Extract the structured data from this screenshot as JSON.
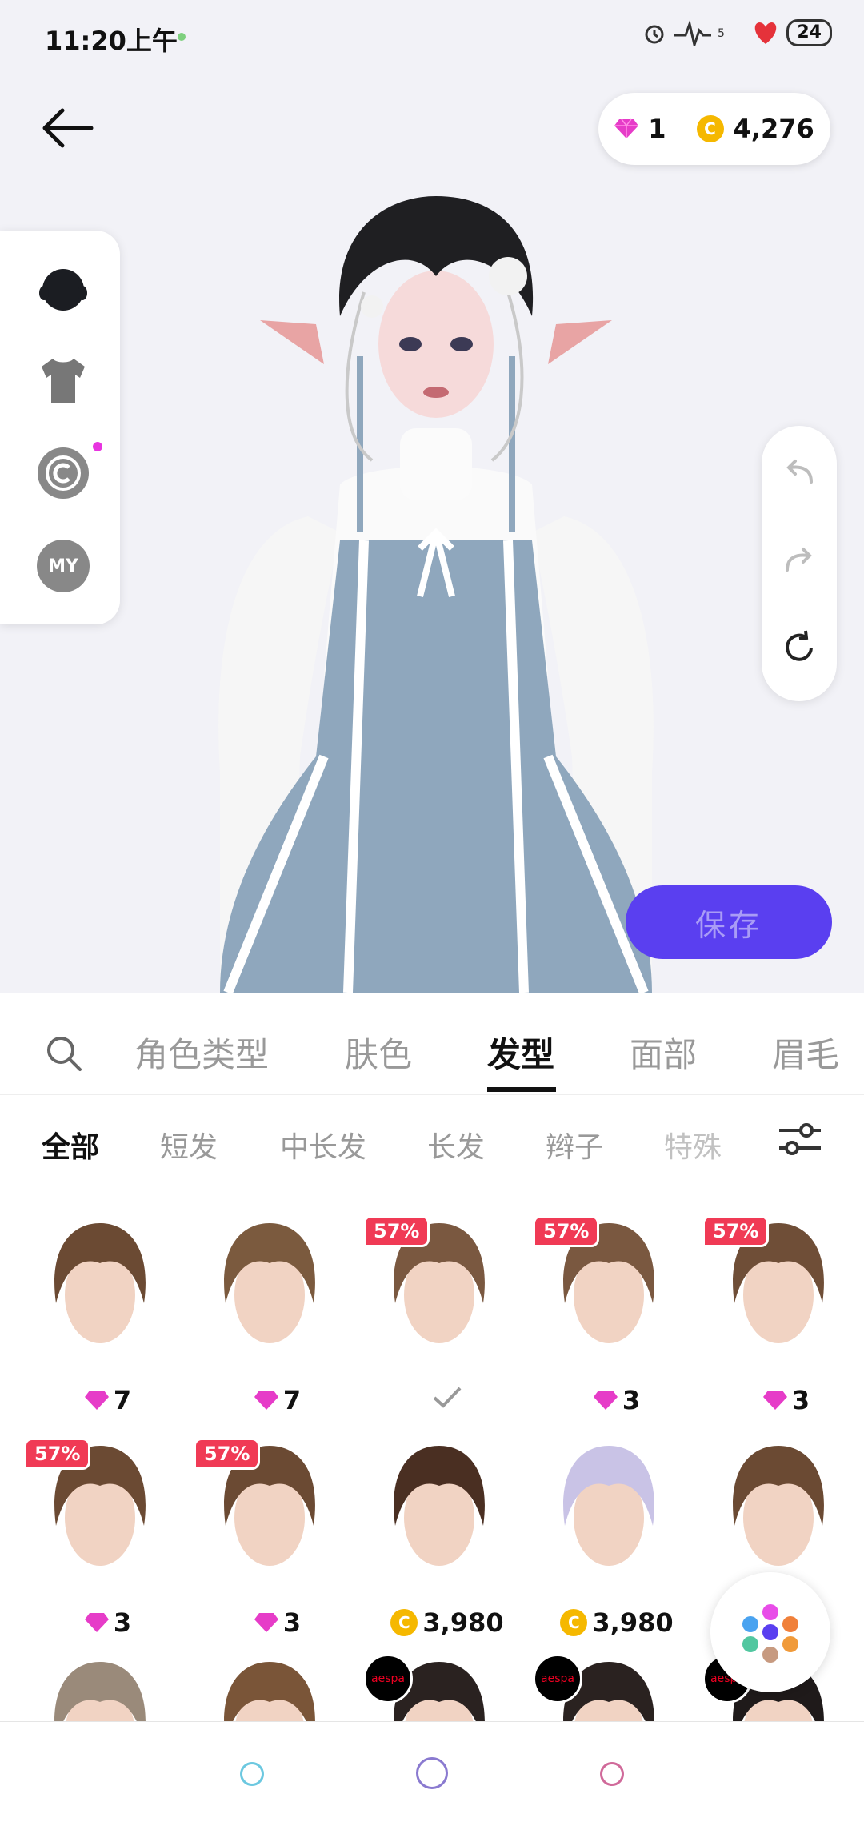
{
  "status_bar": {
    "time": "11:20上午",
    "battery": "24"
  },
  "currency": {
    "gems": "1",
    "coins": "4,276"
  },
  "side_menu": [
    "head-icon",
    "tshirt-icon",
    "copyright-icon",
    "my-icon"
  ],
  "side_my_label": "MY",
  "save_label": "保存",
  "tabs": [
    "角色类型",
    "肤色",
    "发型",
    "面部",
    "眉毛"
  ],
  "active_tab": "发型",
  "subtabs": [
    "全部",
    "短发",
    "中长发",
    "长发",
    "辫子",
    "特殊"
  ],
  "active_subtab": "全部",
  "hair_items": [
    {
      "badge": "",
      "price_type": "gem",
      "price": "7",
      "hair": "#6b4a33"
    },
    {
      "badge": "",
      "price_type": "gem",
      "price": "7",
      "hair": "#7b5a3e"
    },
    {
      "badge": "57%",
      "price_type": "owned",
      "price": "",
      "hair": "#7a5840"
    },
    {
      "badge": "57%",
      "price_type": "gem",
      "price": "3",
      "hair": "#7a5840"
    },
    {
      "badge": "57%",
      "price_type": "gem",
      "price": "3",
      "hair": "#6f4e37"
    },
    {
      "badge": "57%",
      "price_type": "gem",
      "price": "3",
      "hair": "#6b4a33"
    },
    {
      "badge": "57%",
      "price_type": "gem",
      "price": "3",
      "hair": "#6b4a33"
    },
    {
      "badge": "",
      "price_type": "coin",
      "price": "3,980",
      "hair": "#4a2f22"
    },
    {
      "badge": "",
      "price_type": "coin",
      "price": "3,980",
      "hair": "#c9c3e6"
    },
    {
      "badge": "",
      "price_type": "none",
      "price": "",
      "hair": "#6b4a33"
    }
  ],
  "row3_items": [
    {
      "aespa": false,
      "hair": "#9a8a7a"
    },
    {
      "aespa": false,
      "hair": "#7a5538"
    },
    {
      "aespa": true,
      "hair": "#2a2220"
    },
    {
      "aespa": true,
      "hair": "#2a2220"
    },
    {
      "aespa": true,
      "hair": "#1f1a1a"
    }
  ],
  "aespa_label": "aespa",
  "colors": {
    "accent": "#5a3ff0",
    "badge": "#f03a55",
    "gem": "#e63cc8",
    "coin": "#f5b800"
  }
}
